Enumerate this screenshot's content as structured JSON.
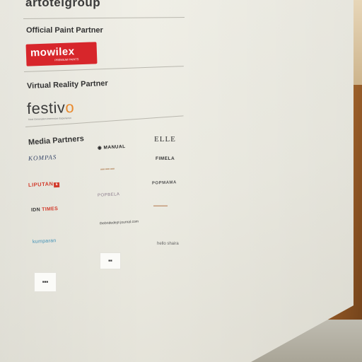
{
  "header": {
    "brand": "artotelgroup"
  },
  "sections": {
    "paint": {
      "title": "Official Paint Partner",
      "logo_text": "mowilex",
      "logo_subtext": "PREMIUM PAINTS"
    },
    "vr": {
      "title": "Virtual Reality Partner",
      "logo_text_main": "festiv",
      "logo_text_accent": "o",
      "logo_tagline": "Next Generation Immersive Experience"
    },
    "media": {
      "title": "Media Partners",
      "logos": {
        "kompas": "KOMPAS",
        "manual": "MANUAL",
        "elle": "ELLE",
        "fimela": "FIMELA",
        "liputan": "LIPUTAN",
        "liputan_num": "6",
        "popmama": "POPMAMA",
        "popbela": "POPBELA",
        "idn_main": "IDN",
        "idn_accent": "TIMES",
        "weddingjournal": "thebridedept journal.com",
        "kumparan": "kumparan",
        "hello": "hello shaira"
      }
    }
  },
  "colors": {
    "mowilex_red": "#d7262b",
    "festivo_accent": "#e98a2e",
    "wood": "#b07033"
  }
}
